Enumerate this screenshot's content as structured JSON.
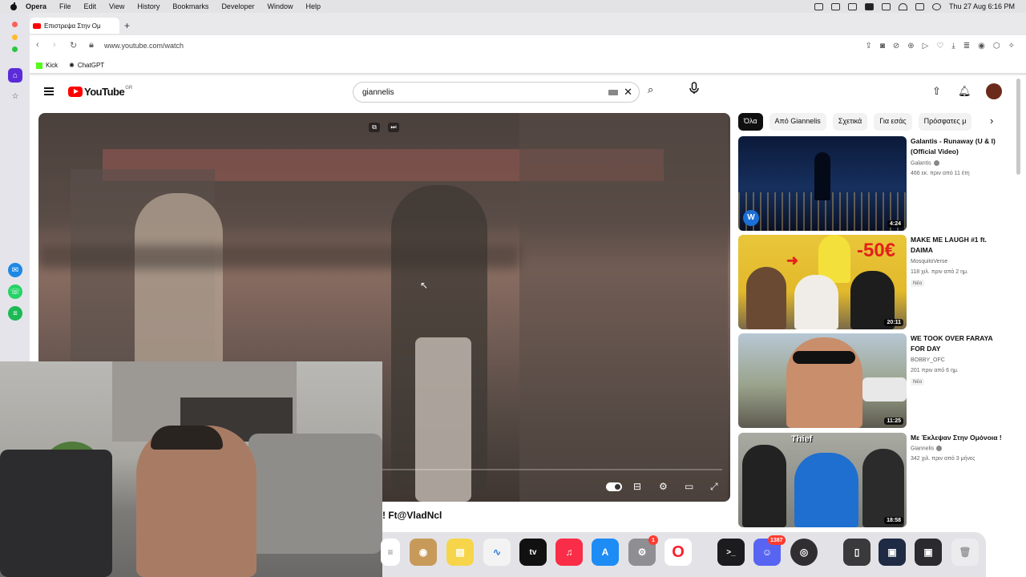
{
  "menubar": {
    "app": "Opera",
    "items": [
      "File",
      "Edit",
      "View",
      "History",
      "Bookmarks",
      "Developer",
      "Window",
      "Help"
    ],
    "clock": "Thu 27 Aug  6:16 PM"
  },
  "browser": {
    "tab_title": "Επιστρεψα Στην Ομ",
    "url": "www.youtube.com/watch",
    "bookmarks": [
      "Kick",
      "ChatGPT"
    ]
  },
  "youtube": {
    "logo": "YouTube",
    "country": "GR",
    "search_value": "giannelis",
    "video_title_partial": "! Ft@VladNcl",
    "chips": [
      "Όλα",
      "Από Giannelis",
      "Σχετικά",
      "Για εσάς",
      "Πρόσφατες μ"
    ],
    "recommendations": [
      {
        "title": "Galantis - Runaway (U & I) (Official Video)",
        "channel": "Galantis",
        "verified": true,
        "meta": "466 εκ.  πριν από 11 έτη",
        "duration": "4:24",
        "new": ""
      },
      {
        "title": "MAKE ME LAUGH #1 ft. DAIMA",
        "channel": "MosquitoVerse",
        "verified": false,
        "meta": "118 χιλ.  πριν από 2 ημ.",
        "duration": "20:11",
        "new": "Νέο"
      },
      {
        "title": "WE TOOK OVER FARAYA FOR DAY",
        "channel": "BOBBY_OFC",
        "verified": false,
        "meta": "201  πριν από 6 ημ.",
        "duration": "11:25",
        "new": "Νέο"
      },
      {
        "title": "Με Έκλεψαν Στην Ομόνοια !",
        "channel": "Giannelis",
        "verified": true,
        "meta": "342 χιλ.  πριν από 3 μήνες",
        "duration": "18:58",
        "new": ""
      }
    ],
    "thumb_texts": {
      "t2_price": "-50€",
      "t4_label": "Thief"
    }
  },
  "dock": {
    "settings_badge": "1",
    "discord_badge": "1387"
  },
  "colors": {
    "yt_red": "#ff0000",
    "opera_red": "#ff1b2d"
  }
}
